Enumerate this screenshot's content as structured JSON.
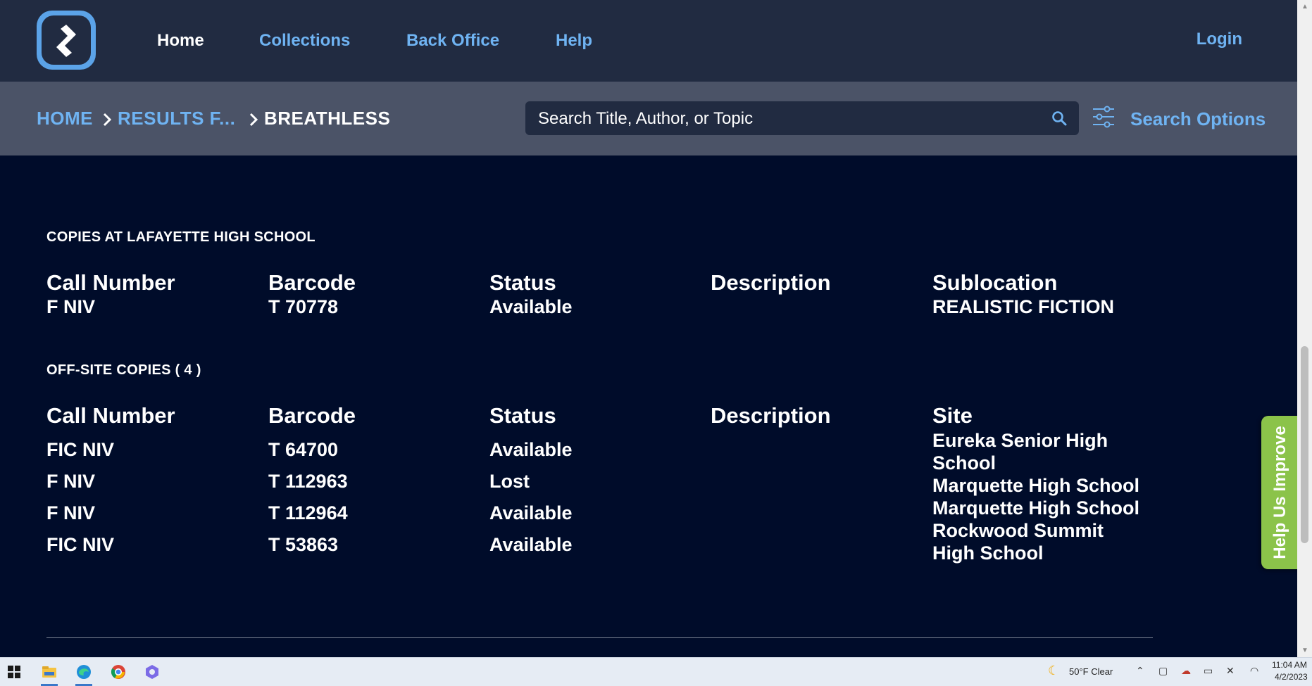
{
  "nav": {
    "items": [
      {
        "label": "Home",
        "active": true
      },
      {
        "label": "Collections"
      },
      {
        "label": "Back Office"
      },
      {
        "label": "Help"
      }
    ],
    "login": "Login"
  },
  "breadcrumb": [
    "HOME",
    "RESULTS F...",
    "BREATHLESS"
  ],
  "search": {
    "placeholder": "Search Title, Author, or Topic",
    "options_label": "Search Options"
  },
  "local_copies": {
    "heading": "COPIES AT LAFAYETTE HIGH SCHOOL",
    "columns": [
      "Call Number",
      "Barcode",
      "Status",
      "Description",
      "Sublocation"
    ],
    "rows": [
      {
        "call_number": "F NIV",
        "barcode": "T 70778",
        "status": "Available",
        "description": "",
        "sublocation": "REALISTIC FICTION"
      }
    ]
  },
  "offsite_copies": {
    "heading": "OFF-SITE COPIES ( 4 )",
    "columns": [
      "Call Number",
      "Barcode",
      "Status",
      "Description",
      "Site"
    ],
    "rows": [
      {
        "call_number": "FIC NIV",
        "barcode": "T 64700",
        "status": "Available",
        "description": ""
      },
      {
        "call_number": "F NIV",
        "barcode": "T 112963",
        "status": "Lost",
        "description": ""
      },
      {
        "call_number": "F NIV",
        "barcode": "T 112964",
        "status": "Available",
        "description": ""
      },
      {
        "call_number": "FIC NIV",
        "barcode": "T 53863",
        "status": "Available",
        "description": ""
      }
    ],
    "sites": [
      "Eureka Senior High",
      "School",
      "Marquette High School",
      "Marquette High School",
      "Rockwood Summit",
      "High School"
    ]
  },
  "help_tab": "Help Us Improve",
  "taskbar": {
    "weather": "50°F  Clear",
    "time": "11:04 AM",
    "date": "4/2/2023"
  },
  "colors": {
    "page_bg": "#000c2a",
    "nav_bg": "#212b41",
    "subbar_bg": "#4b5367",
    "link": "#6fb3f2",
    "help_tab": "#8bc34a"
  }
}
